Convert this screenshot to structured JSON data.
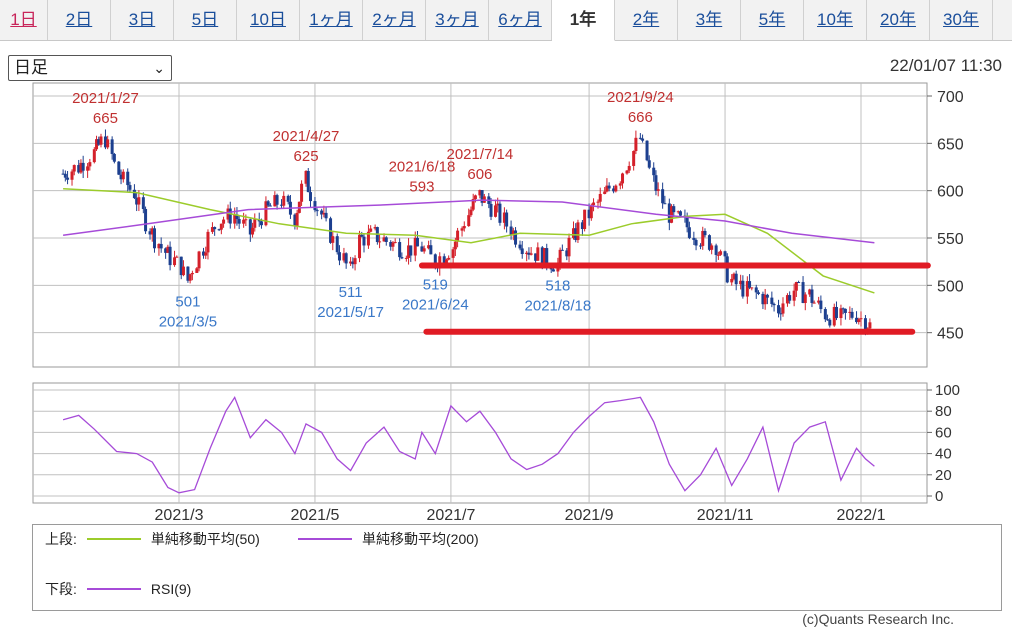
{
  "tabs": [
    {
      "label": "1日"
    },
    {
      "label": "2日"
    },
    {
      "label": "3日"
    },
    {
      "label": "5日"
    },
    {
      "label": "10日"
    },
    {
      "label": "1ヶ月"
    },
    {
      "label": "2ヶ月"
    },
    {
      "label": "3ヶ月"
    },
    {
      "label": "6ヶ月"
    },
    {
      "label": "1年"
    },
    {
      "label": "2年"
    },
    {
      "label": "3年"
    },
    {
      "label": "5年"
    },
    {
      "label": "10年"
    },
    {
      "label": "20年"
    },
    {
      "label": "30年"
    }
  ],
  "active_tab": "1年",
  "period_select": {
    "value": "日足"
  },
  "datetime": "22/01/07 11:30",
  "legend": {
    "upper_label": "上段:",
    "sma50": "単純移動平均(50)",
    "sma200": "単純移動平均(200)",
    "lower_label": "下段:",
    "rsi": "RSI(9)"
  },
  "copyright": "(c)Quants Research Inc.",
  "colors": {
    "up": "#d4202a",
    "down": "#1c3f8f",
    "sma50": "#9ccc2b",
    "sma200": "#a64bd8",
    "rsi": "#a64bd8",
    "annot_high": "#c03030",
    "annot_low": "#3a78c8",
    "line": "#e01b24"
  },
  "chart_data": [
    {
      "type": "candlestick",
      "title": "",
      "ylim": [
        400,
        700
      ],
      "yticks": [
        450,
        500,
        550,
        600,
        650,
        700
      ],
      "xticks": [
        "2021/3",
        "2021/5",
        "2021/7",
        "2021/9",
        "2021/11",
        "2022/1"
      ],
      "xtick_dates": [
        "2021-03-01",
        "2021-05-01",
        "2021-07-01",
        "2021-09-01",
        "2021-11-01",
        "2022-01-01"
      ],
      "close_series": [
        [
          "2021-01-08",
          618
        ],
        [
          "2021-01-15",
          625
        ],
        [
          "2021-01-22",
          640
        ],
        [
          "2021-01-27",
          655
        ],
        [
          "2021-02-02",
          618
        ],
        [
          "2021-02-09",
          598
        ],
        [
          "2021-02-16",
          560
        ],
        [
          "2021-02-23",
          535
        ],
        [
          "2021-03-02",
          520
        ],
        [
          "2021-03-05",
          505
        ],
        [
          "2021-03-12",
          540
        ],
        [
          "2021-03-19",
          568
        ],
        [
          "2021-03-26",
          575
        ],
        [
          "2021-04-02",
          555
        ],
        [
          "2021-04-09",
          578
        ],
        [
          "2021-04-16",
          590
        ],
        [
          "2021-04-22",
          572
        ],
        [
          "2021-04-27",
          612
        ],
        [
          "2021-05-04",
          575
        ],
        [
          "2021-05-11",
          540
        ],
        [
          "2021-05-17",
          515
        ],
        [
          "2021-05-21",
          548
        ],
        [
          "2021-05-28",
          553
        ],
        [
          "2021-06-04",
          545
        ],
        [
          "2021-06-11",
          538
        ],
        [
          "2021-06-18",
          540
        ],
        [
          "2021-06-24",
          525
        ],
        [
          "2021-07-02",
          540
        ],
        [
          "2021-07-09",
          575
        ],
        [
          "2021-07-14",
          595
        ],
        [
          "2021-07-21",
          580
        ],
        [
          "2021-07-28",
          560
        ],
        [
          "2021-08-04",
          540
        ],
        [
          "2021-08-11",
          530
        ],
        [
          "2021-08-18",
          522
        ],
        [
          "2021-08-25",
          550
        ],
        [
          "2021-09-01",
          575
        ],
        [
          "2021-09-08",
          595
        ],
        [
          "2021-09-15",
          615
        ],
        [
          "2021-09-24",
          655
        ],
        [
          "2021-09-30",
          610
        ],
        [
          "2021-10-07",
          575
        ],
        [
          "2021-10-14",
          565
        ],
        [
          "2021-10-21",
          550
        ],
        [
          "2021-10-28",
          543
        ],
        [
          "2021-11-04",
          505
        ],
        [
          "2021-11-11",
          495
        ],
        [
          "2021-11-18",
          488
        ],
        [
          "2021-11-25",
          475
        ],
        [
          "2021-12-02",
          495
        ],
        [
          "2021-12-09",
          490
        ],
        [
          "2021-12-16",
          470
        ],
        [
          "2021-12-23",
          465
        ],
        [
          "2021-12-30",
          470
        ],
        [
          "2022-01-07",
          455
        ]
      ],
      "sma50": [
        [
          "2021-01-08",
          602
        ],
        [
          "2021-02-10",
          598
        ],
        [
          "2021-03-15",
          580
        ],
        [
          "2021-04-15",
          565
        ],
        [
          "2021-05-15",
          555
        ],
        [
          "2021-06-15",
          553
        ],
        [
          "2021-07-10",
          545
        ],
        [
          "2021-08-01",
          555
        ],
        [
          "2021-09-01",
          553
        ],
        [
          "2021-09-20",
          565
        ],
        [
          "2021-10-15",
          573
        ],
        [
          "2021-11-01",
          575
        ],
        [
          "2021-11-20",
          555
        ],
        [
          "2021-12-15",
          510
        ],
        [
          "2022-01-07",
          492
        ]
      ],
      "sma200": [
        [
          "2021-01-08",
          553
        ],
        [
          "2021-02-15",
          565
        ],
        [
          "2021-04-01",
          580
        ],
        [
          "2021-06-01",
          585
        ],
        [
          "2021-07-15",
          590
        ],
        [
          "2021-08-20",
          588
        ],
        [
          "2021-10-01",
          575
        ],
        [
          "2021-11-01",
          568
        ],
        [
          "2021-12-01",
          555
        ],
        [
          "2022-01-07",
          545
        ]
      ],
      "annotations_high": [
        {
          "date": "2021-01-27",
          "label": "2021/1/27",
          "value": "665"
        },
        {
          "date": "2021-04-27",
          "label": "2021/4/27",
          "value": "625"
        },
        {
          "date": "2021-06-18",
          "label": "2021/6/18",
          "value": "593"
        },
        {
          "date": "2021-07-14",
          "label": "2021/7/14",
          "value": "606"
        },
        {
          "date": "2021-09-24",
          "label": "2021/9/24",
          "value": "666"
        }
      ],
      "annotations_low": [
        {
          "date": "2021-03-05",
          "label": "2021/3/5",
          "value": "501"
        },
        {
          "date": "2021-05-17",
          "label": "2021/5/17",
          "value": "511"
        },
        {
          "date": "2021-06-24",
          "label": "2021/6/24",
          "value": "519"
        },
        {
          "date": "2021-08-18",
          "label": "2021/8/18",
          "value": "518"
        }
      ],
      "hlines": [
        {
          "from": "2021-06-18",
          "to": "2022-01-31",
          "value": 521
        },
        {
          "from": "2021-06-20",
          "to": "2022-01-24",
          "value": 451
        }
      ]
    },
    {
      "type": "line",
      "name": "RSI(9)",
      "ylim": [
        0,
        100
      ],
      "yticks": [
        0,
        20,
        40,
        60,
        80,
        100
      ],
      "series": [
        [
          "2021-01-08",
          72
        ],
        [
          "2021-01-15",
          76
        ],
        [
          "2021-01-22",
          63
        ],
        [
          "2021-02-01",
          42
        ],
        [
          "2021-02-10",
          40
        ],
        [
          "2021-02-17",
          32
        ],
        [
          "2021-02-24",
          8
        ],
        [
          "2021-03-01",
          3
        ],
        [
          "2021-03-08",
          6
        ],
        [
          "2021-03-15",
          45
        ],
        [
          "2021-03-22",
          80
        ],
        [
          "2021-03-26",
          93
        ],
        [
          "2021-04-02",
          55
        ],
        [
          "2021-04-09",
          72
        ],
        [
          "2021-04-16",
          60
        ],
        [
          "2021-04-22",
          40
        ],
        [
          "2021-04-27",
          68
        ],
        [
          "2021-05-04",
          60
        ],
        [
          "2021-05-11",
          35
        ],
        [
          "2021-05-17",
          24
        ],
        [
          "2021-05-24",
          50
        ],
        [
          "2021-06-01",
          65
        ],
        [
          "2021-06-08",
          42
        ],
        [
          "2021-06-15",
          35
        ],
        [
          "2021-06-18",
          60
        ],
        [
          "2021-06-24",
          40
        ],
        [
          "2021-07-01",
          85
        ],
        [
          "2021-07-08",
          70
        ],
        [
          "2021-07-14",
          80
        ],
        [
          "2021-07-21",
          60
        ],
        [
          "2021-07-28",
          35
        ],
        [
          "2021-08-04",
          25
        ],
        [
          "2021-08-11",
          30
        ],
        [
          "2021-08-18",
          40
        ],
        [
          "2021-08-25",
          60
        ],
        [
          "2021-09-01",
          75
        ],
        [
          "2021-09-08",
          88
        ],
        [
          "2021-09-15",
          90
        ],
        [
          "2021-09-24",
          93
        ],
        [
          "2021-09-30",
          70
        ],
        [
          "2021-10-07",
          30
        ],
        [
          "2021-10-14",
          5
        ],
        [
          "2021-10-21",
          20
        ],
        [
          "2021-10-28",
          45
        ],
        [
          "2021-11-04",
          10
        ],
        [
          "2021-11-11",
          35
        ],
        [
          "2021-11-18",
          65
        ],
        [
          "2021-11-25",
          5
        ],
        [
          "2021-12-02",
          50
        ],
        [
          "2021-12-09",
          65
        ],
        [
          "2021-12-16",
          70
        ],
        [
          "2021-12-23",
          15
        ],
        [
          "2021-12-30",
          45
        ],
        [
          "2022-01-03",
          35
        ],
        [
          "2022-01-07",
          28
        ]
      ]
    }
  ]
}
